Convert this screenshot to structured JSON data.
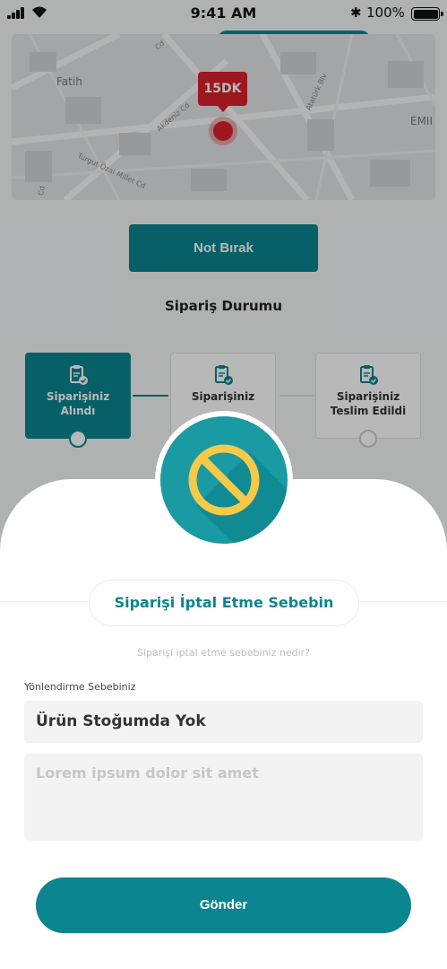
{
  "status_bar": {
    "time": "9:41 AM",
    "battery": "100%"
  },
  "map": {
    "eta": "15DK",
    "labels": [
      "Fatih",
      "EMII"
    ],
    "streets": [
      "Akdeniz Cd",
      "Atatürk Blv",
      "Turgut Özal Millet Cd",
      "Cd",
      "Cd"
    ]
  },
  "note_button": "Not Bırak",
  "order_status": {
    "title": "Sipariş Durumu",
    "steps": [
      {
        "label": "Siparişiniz Alındı"
      },
      {
        "label": "Siparişiniz"
      },
      {
        "label": "Siparişiniz Teslim Edildi"
      }
    ]
  },
  "cancel_sheet": {
    "title": "Siparişi İptal Etme Sebebin",
    "subtitle": "Siparişi iptal etme sebebiniz nedir?",
    "field_label": "Yönlendirme Sebebiniz",
    "reason_value": "Ürün Stoğumda Yok",
    "note_placeholder": "Lorem ipsum dolor sit amet",
    "submit": "Gönder"
  },
  "colors": {
    "accent": "#0b8590",
    "danger": "#d8222a",
    "icon_yellow": "#f7c948"
  }
}
